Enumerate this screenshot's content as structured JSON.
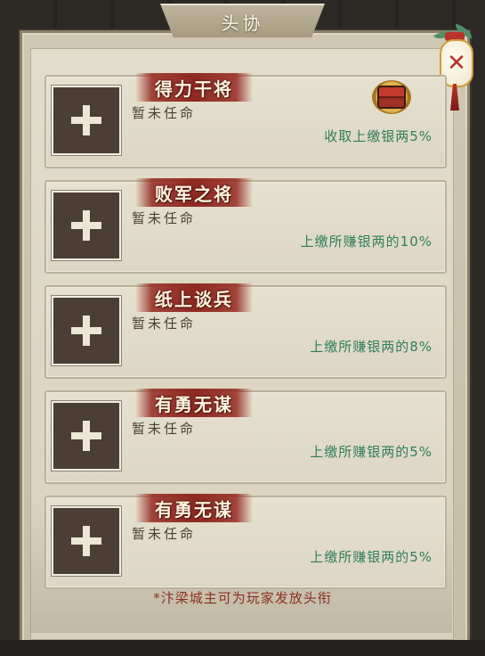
{
  "window": {
    "title": "头协"
  },
  "colors": {
    "reward_text": "#2f7f5a",
    "rank_ribbon": "#8f2a22",
    "footer_text": "#8a2f24"
  },
  "positions": [
    {
      "rank": "得力干将",
      "status": "暂未任命",
      "reward": "收取上缴银两5%",
      "icon": "treasure-chest-icon"
    },
    {
      "rank": "败军之将",
      "status": "暂未任命",
      "reward": "上缴所赚银两的10%"
    },
    {
      "rank": "纸上谈兵",
      "status": "暂未任命",
      "reward": "上缴所赚银两的8%"
    },
    {
      "rank": "有勇无谋",
      "status": "暂未任命",
      "reward": "上缴所赚银两的5%"
    },
    {
      "rank": "有勇无谋",
      "status": "暂未任命",
      "reward": "上缴所赚银两的5%"
    }
  ],
  "footer": {
    "note": "*汴梁城主可为玩家发放头衔"
  },
  "close": {
    "icon": "close-icon"
  },
  "slot": {
    "icon": "plus-icon"
  }
}
